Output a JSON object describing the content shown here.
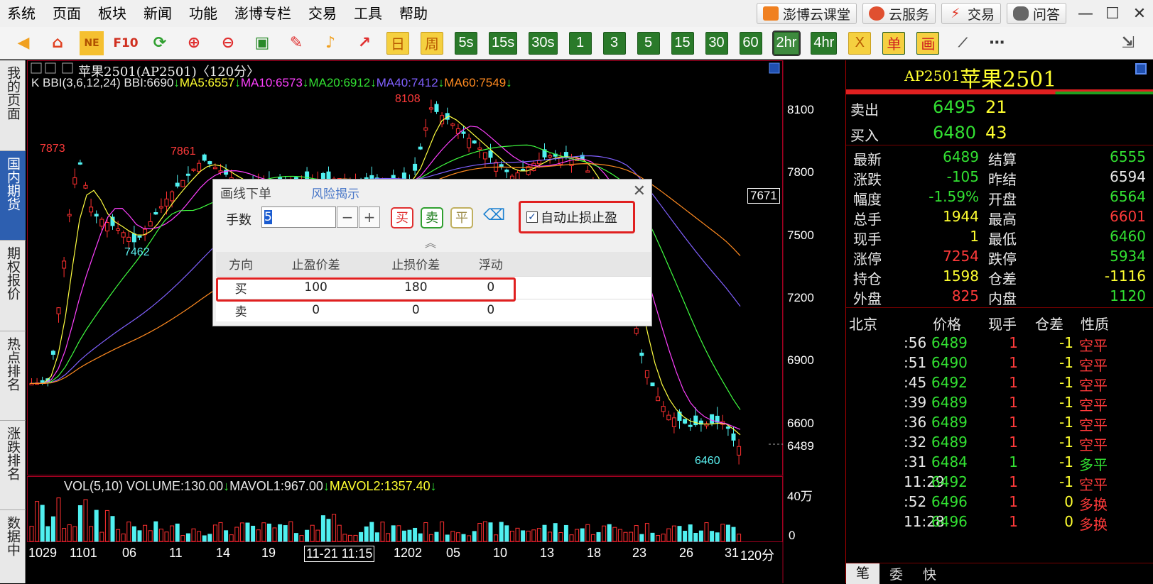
{
  "menu": {
    "items": [
      "系统",
      "页面",
      "板块",
      "新闻",
      "功能",
      "澎博专栏",
      "交易",
      "工具",
      "帮助"
    ],
    "services": [
      "澎博云课堂",
      "云服务",
      "交易",
      "问答"
    ]
  },
  "toolbar": {
    "periods": [
      "日",
      "周",
      "5s",
      "15s",
      "30s",
      "1",
      "3",
      "5",
      "15",
      "30",
      "60",
      "2hr",
      "4hr",
      "X",
      "单",
      "画"
    ],
    "active_period": "2hr"
  },
  "sidebar": {
    "tabs": [
      "我的页面",
      "国内期货",
      "期权报价",
      "热点排名",
      "涨跌排名",
      "数据中"
    ]
  },
  "chart": {
    "title": "苹果2501(AP2501)〈120分〉",
    "indicator_bbi": "K BBI(3,6,12,24) BBI:6690",
    "ma5": "MA5:6557",
    "ma10": "MA10:6573",
    "ma20": "MA20:6912",
    "ma40": "MA40:7412",
    "ma60": "MA60:7549",
    "vol_main": "VOL(5,10) VOLUME:130.00",
    "mavol1": "MAVOL1:967.00",
    "mavol2": "MAVOL2:1357.40",
    "price_axis": [
      "8100",
      "7800",
      "7500",
      "7200",
      "6900",
      "6600"
    ],
    "current_price": "6489",
    "crosshair_price": "7671",
    "vol_axis": [
      "40万",
      "0"
    ],
    "x_labels": [
      "1029",
      "1101",
      "06",
      "11",
      "14",
      "19",
      "1202",
      "05",
      "10",
      "13",
      "18",
      "23",
      "26",
      "31"
    ],
    "x_cursor": "11-21 11:15",
    "period_label": "120分",
    "annotations": {
      "high": "8108",
      "peak1": "7873",
      "peak2": "7861",
      "trough": "7462",
      "low": "6460"
    }
  },
  "dialog": {
    "title": "画线下单",
    "risk_link": "风险揭示",
    "qty_label": "手数",
    "qty_value": "5",
    "buy": "买",
    "sell": "卖",
    "flat": "平",
    "auto_stop": "自动止损止盈",
    "columns": [
      "方向",
      "止盈价差",
      "止损价差",
      "浮动"
    ],
    "rows": [
      {
        "dir": "买",
        "tp": "100",
        "sl": "180",
        "float": "0"
      },
      {
        "dir": "卖",
        "tp": "0",
        "sl": "0",
        "float": "0"
      }
    ]
  },
  "quote": {
    "code": "AP2501",
    "name": "苹果2501",
    "ask_label": "卖出",
    "ask_price": "6495",
    "ask_vol": "21",
    "bid_label": "买入",
    "bid_price": "6480",
    "bid_vol": "43",
    "left": [
      {
        "k": "最新",
        "v": "6489"
      },
      {
        "k": "涨跌",
        "v": "-105"
      },
      {
        "k": "幅度",
        "v": "-1.59%"
      },
      {
        "k": "总手",
        "v": "1944"
      },
      {
        "k": "现手",
        "v": "1"
      },
      {
        "k": "涨停",
        "v": "7254"
      },
      {
        "k": "持仓",
        "v": "1598"
      },
      {
        "k": "外盘",
        "v": "825"
      }
    ],
    "right": [
      {
        "k": "结算",
        "v": "6555"
      },
      {
        "k": "昨结",
        "v": "6594"
      },
      {
        "k": "开盘",
        "v": "6564"
      },
      {
        "k": "最高",
        "v": "6601"
      },
      {
        "k": "最低",
        "v": "6460"
      },
      {
        "k": "跌停",
        "v": "5934"
      },
      {
        "k": "仓差",
        "v": "-1116"
      },
      {
        "k": "内盘",
        "v": "1120"
      }
    ]
  },
  "ticks": {
    "headers": [
      "北京",
      "价格",
      "现手",
      "仓差",
      "性质"
    ],
    "rows": [
      {
        "t": ":56",
        "p": "6489",
        "v": "1",
        "oi": "-1",
        "n": "空平"
      },
      {
        "t": ":51",
        "p": "6490",
        "v": "1",
        "oi": "-1",
        "n": "空平"
      },
      {
        "t": ":45",
        "p": "6492",
        "v": "1",
        "oi": "-1",
        "n": "空平"
      },
      {
        "t": ":39",
        "p": "6489",
        "v": "1",
        "oi": "-1",
        "n": "空平"
      },
      {
        "t": ":36",
        "p": "6489",
        "v": "1",
        "oi": "-1",
        "n": "空平"
      },
      {
        "t": ":32",
        "p": "6489",
        "v": "1",
        "oi": "-1",
        "n": "空平"
      },
      {
        "t": ":31",
        "p": "6484",
        "v": "1",
        "oi": "-1",
        "n": "多平"
      },
      {
        "t": "11:29",
        "p": "6492",
        "v": "1",
        "oi": "-1",
        "n": "空平"
      },
      {
        "t": ":52",
        "p": "6496",
        "v": "1",
        "oi": "0",
        "n": "多换"
      },
      {
        "t": "11:28",
        "p": "6496",
        "v": "1",
        "oi": "0",
        "n": "多换"
      }
    ],
    "tabs": [
      "笔",
      "委",
      "快"
    ]
  }
}
